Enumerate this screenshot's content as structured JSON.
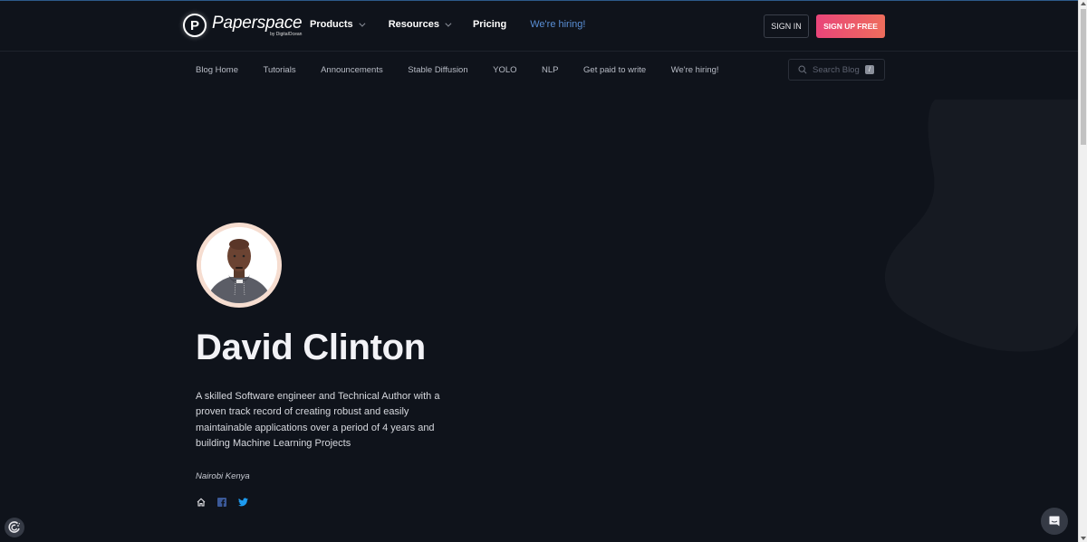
{
  "header": {
    "logo": {
      "word": "Paperspace",
      "sub": "by DigitalOcean",
      "mark": "P"
    },
    "nav": [
      {
        "label": "Products",
        "has_dropdown": true
      },
      {
        "label": "Resources",
        "has_dropdown": true
      },
      {
        "label": "Pricing",
        "has_dropdown": false
      }
    ],
    "hiring_link": "We're hiring!",
    "sign_in": "SIGN IN",
    "sign_up": "SIGN UP FREE"
  },
  "subnav": {
    "items": [
      "Blog Home",
      "Tutorials",
      "Announcements",
      "Stable Diffusion",
      "YOLO",
      "NLP",
      "Get paid to write",
      "We're hiring!"
    ],
    "search_placeholder": "Search Blog",
    "search_shortcut": "/"
  },
  "profile": {
    "name": "David Clinton",
    "bio": "A skilled Software engineer and Technical Author with a proven track record of creating robust and easily maintainable applications over a period of 4 years and building Machine Learning Projects",
    "location": "Nairobi Kenya",
    "socials": [
      {
        "icon": "home-icon",
        "label": "Website"
      },
      {
        "icon": "facebook-icon",
        "label": "Facebook"
      },
      {
        "icon": "twitter-icon",
        "label": "Twitter"
      }
    ]
  },
  "colors": {
    "background": "#0f131b",
    "accent_gradient_start": "#e9457a",
    "accent_gradient_end": "#ee6d5c",
    "hiring_link": "#5a8fd6",
    "twitter": "#1d9bf0",
    "facebook": "#3b5998"
  }
}
